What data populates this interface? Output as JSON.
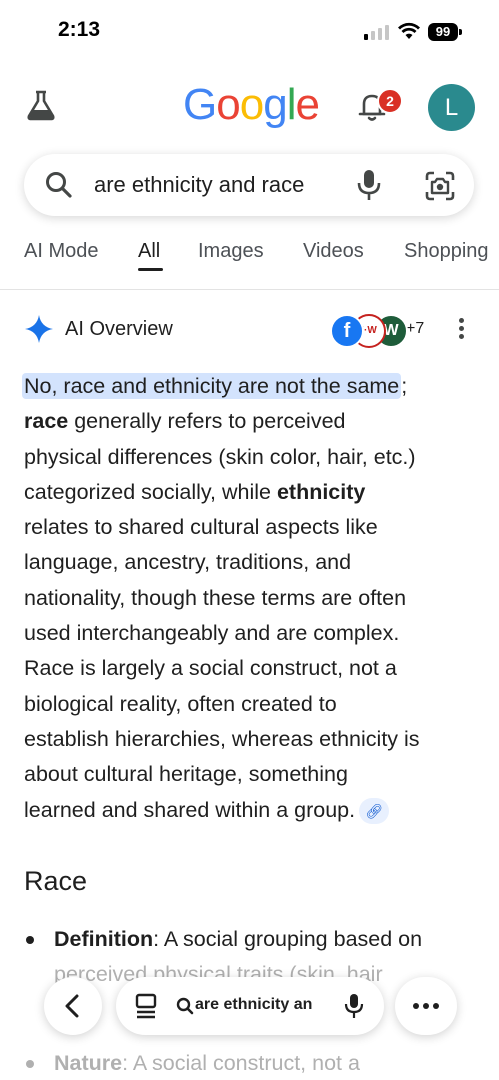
{
  "status_bar": {
    "time": "2:13",
    "battery": "99"
  },
  "header": {
    "logo": "Google",
    "notification_count": "2",
    "avatar_letter": "L"
  },
  "search": {
    "query": "are ethnicity and race"
  },
  "tabs": [
    {
      "label": "AI Mode",
      "active": false
    },
    {
      "label": "All",
      "active": true
    },
    {
      "label": "Images",
      "active": false
    },
    {
      "label": "Videos",
      "active": false
    },
    {
      "label": "Shopping",
      "active": false
    }
  ],
  "ai_overview": {
    "label": "AI Overview",
    "sources_more": "+7",
    "source_icons": [
      "facebook-icon",
      "wiki-source-icon",
      "w-source-icon"
    ],
    "highlight": "No, race and ethnicity are not the same",
    "line1_rest": ";",
    "line2_bold": "race",
    "line2_rest": " generally refers to perceived",
    "line3": "physical differences (skin color, hair, etc.)",
    "line4_pre": "categorized socially, while ",
    "line4_bold": "ethnicity",
    "line5": "relates to shared cultural aspects like",
    "line6": "language, ancestry, traditions, and",
    "line7": "nationality, though these terms are often",
    "line8": "used interchangeably and are complex.",
    "line9": "Race is largely a social construct, not a",
    "line10": "biological reality, often created to",
    "line11": "establish hierarchies, whereas ethnicity is",
    "line12": "about cultural heritage, something",
    "line13": "learned and shared within a group."
  },
  "race_section": {
    "heading": "Race",
    "bullet1_term": "Definition",
    "bullet1_text": ": A social grouping based on",
    "bullet1_cont": "perceived physical traits (skin, hair",
    "bullet2_term": "Nature",
    "bullet2_text": ": A social construct, not a"
  },
  "bottom_bar": {
    "query": "are ethnicity an"
  },
  "colors": {
    "accent": "#0b57d0",
    "highlight": "#d3e3fd",
    "avatar": "#2a8a8e",
    "badge": "#d93025"
  }
}
